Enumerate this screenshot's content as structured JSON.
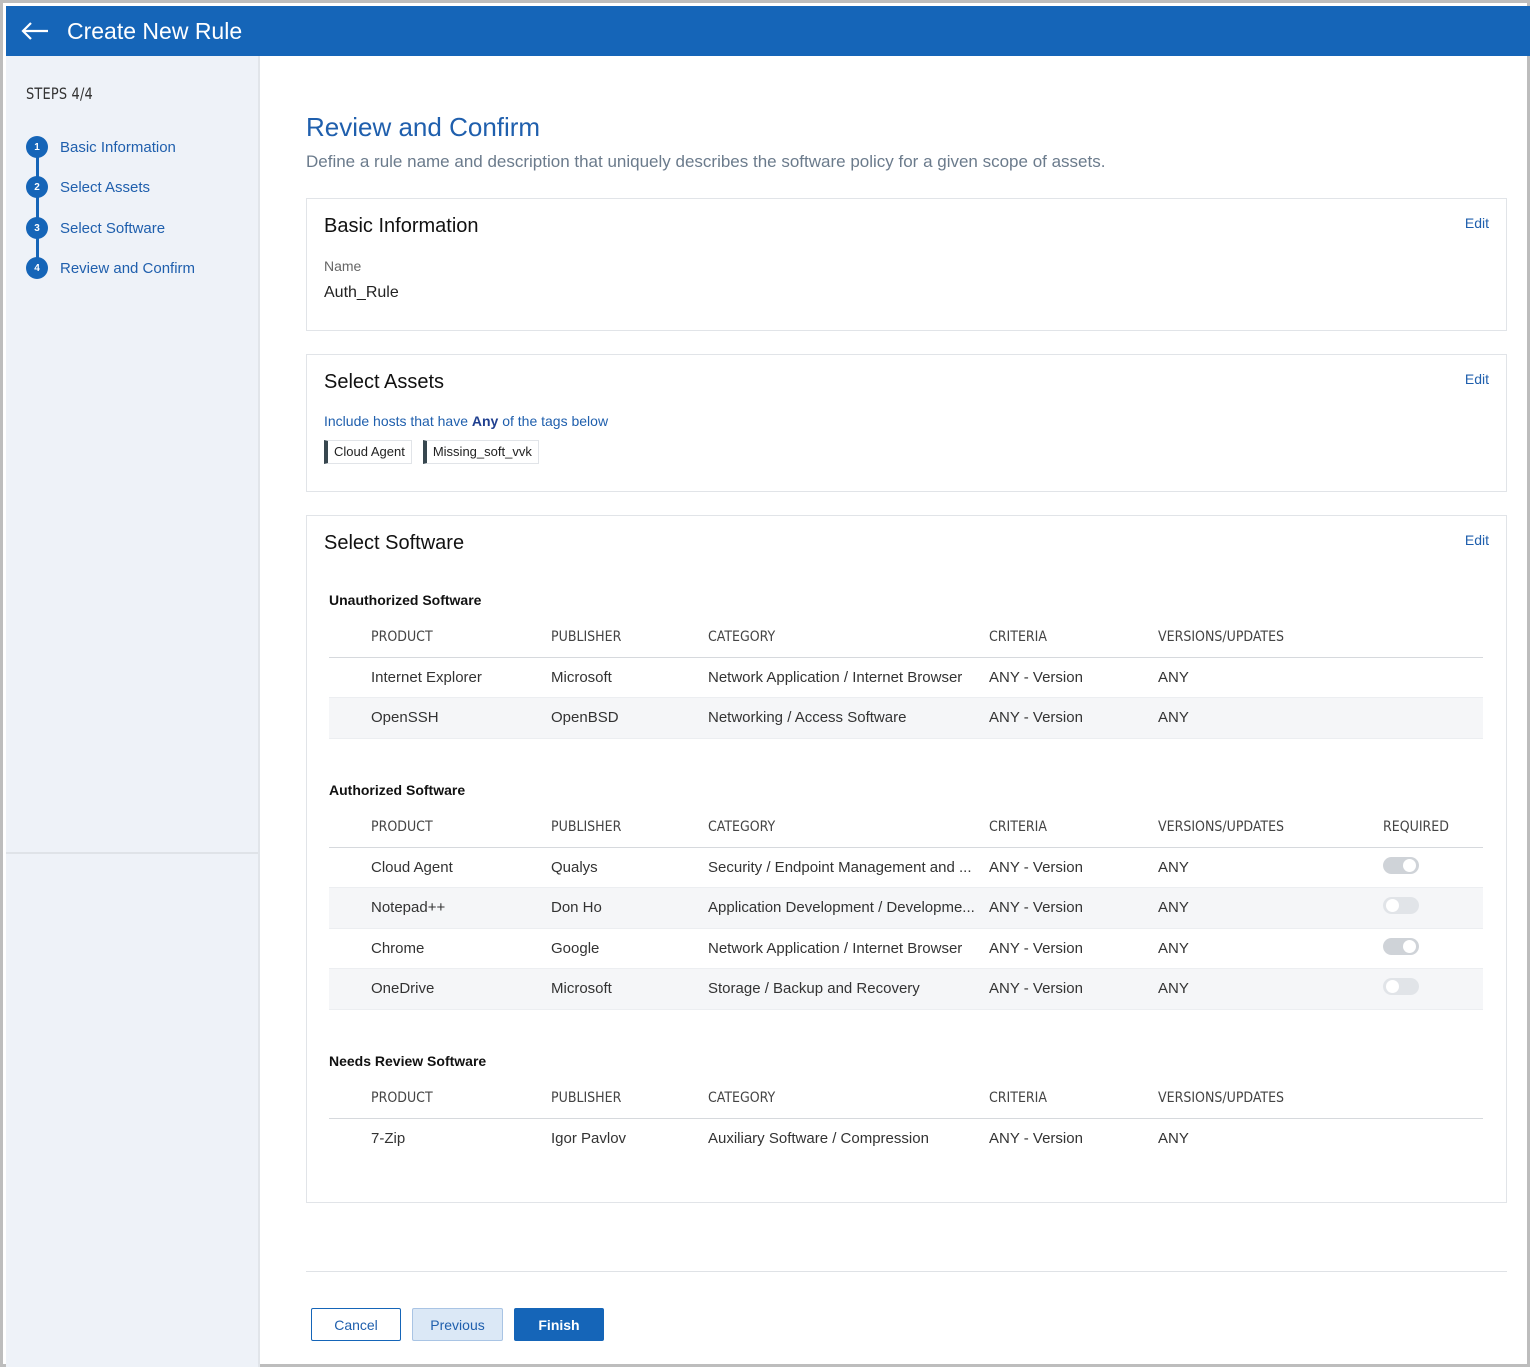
{
  "header": {
    "title": "Create New Rule",
    "back_icon": "arrow-left-icon"
  },
  "sidebar": {
    "steps_label": "STEPS 4/4",
    "steps": [
      {
        "number": "1",
        "label": "Basic Information"
      },
      {
        "number": "2",
        "label": "Select Assets"
      },
      {
        "number": "3",
        "label": "Select Software"
      },
      {
        "number": "4",
        "label": "Review and Confirm"
      }
    ]
  },
  "main": {
    "title": "Review and Confirm",
    "description": "Define a rule name and description that uniquely describes the software policy for a given scope of assets."
  },
  "basic_info": {
    "title": "Basic Information",
    "edit_label": "Edit",
    "name_label": "Name",
    "name_value": "Auth_Rule"
  },
  "assets": {
    "title": "Select Assets",
    "edit_label": "Edit",
    "include_prefix": "Include hosts that have ",
    "include_match": "Any",
    "include_suffix": " of the tags below",
    "tags": [
      "Cloud Agent",
      "Missing_soft_vvk"
    ]
  },
  "software": {
    "title": "Select Software",
    "edit_label": "Edit",
    "columns": {
      "product": "PRODUCT",
      "publisher": "PUBLISHER",
      "category": "CATEGORY",
      "criteria": "CRITERIA",
      "versions": "VERSIONS/UPDATES",
      "required": "REQUIRED"
    },
    "unauthorized": {
      "title": "Unauthorized Software",
      "rows": [
        {
          "product": "Internet Explorer",
          "publisher": "Microsoft",
          "category": "Network Application / Internet Browser",
          "criteria": "ANY - Version",
          "versions": "ANY"
        },
        {
          "product": "OpenSSH",
          "publisher": "OpenBSD",
          "category": "Networking / Access Software",
          "criteria": "ANY - Version",
          "versions": "ANY"
        }
      ]
    },
    "authorized": {
      "title": "Authorized Software",
      "rows": [
        {
          "product": "Cloud Agent",
          "publisher": "Qualys",
          "category": "Security / Endpoint Management and ...",
          "criteria": "ANY - Version",
          "versions": "ANY",
          "required": true
        },
        {
          "product": "Notepad++",
          "publisher": "Don Ho",
          "category": "Application Development / Developme...",
          "criteria": "ANY - Version",
          "versions": "ANY",
          "required": false
        },
        {
          "product": "Chrome",
          "publisher": "Google",
          "category": "Network Application / Internet Browser",
          "criteria": "ANY - Version",
          "versions": "ANY",
          "required": true
        },
        {
          "product": "OneDrive",
          "publisher": "Microsoft",
          "category": "Storage / Backup and Recovery",
          "criteria": "ANY - Version",
          "versions": "ANY",
          "required": false
        }
      ]
    },
    "needs_review": {
      "title": "Needs Review Software",
      "rows": [
        {
          "product": "7-Zip",
          "publisher": "Igor Pavlov",
          "category": "Auxiliary Software / Compression",
          "criteria": "ANY - Version",
          "versions": "ANY"
        }
      ]
    }
  },
  "footer": {
    "cancel_label": "Cancel",
    "previous_label": "Previous",
    "finish_label": "Finish"
  },
  "colors": {
    "brand": "#1565b8",
    "link": "#1f5fad",
    "sidebar_bg": "#eef2f8"
  }
}
